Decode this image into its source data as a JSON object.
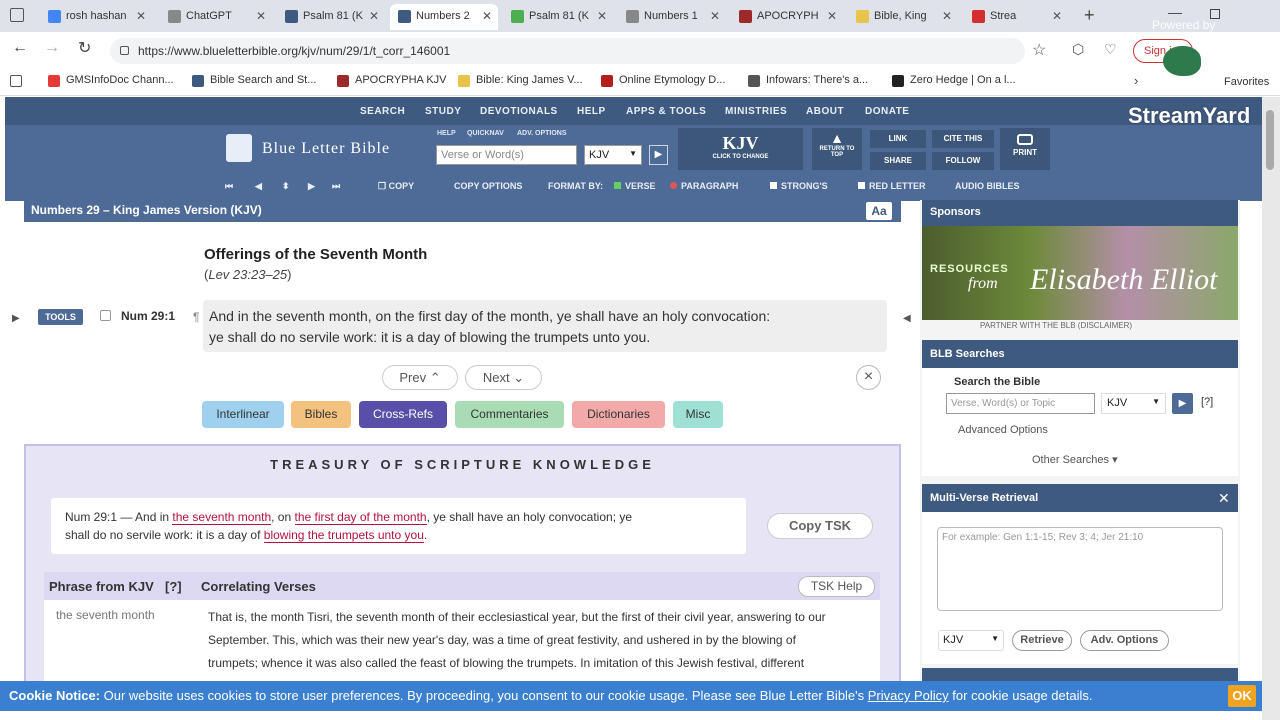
{
  "browser": {
    "tabs": [
      {
        "label": "rosh hashan",
        "color": "#4285f4"
      },
      {
        "label": "ChatGPT",
        "color": "#888888"
      },
      {
        "label": "Psalm 81 (K",
        "color": "#3f5a80"
      },
      {
        "label": "Numbers 2",
        "color": "#3f5a80",
        "active": true
      },
      {
        "label": "Psalm 81 (K",
        "color": "#4caf50"
      },
      {
        "label": "Numbers 1",
        "color": "#888888"
      },
      {
        "label": "APOCRYPH",
        "color": "#9c2a2a"
      },
      {
        "label": "Bible, King",
        "color": "#e8c44a"
      },
      {
        "label": "Strea",
        "color": "#d32f2f"
      }
    ],
    "url": "https://www.blueletterbible.org/kjv/num/29/1/t_corr_146001",
    "sign_in": "Sign in",
    "bookmarks": [
      {
        "label": "GMSInfoDoc Chann...",
        "color": "#e53935"
      },
      {
        "label": "Bible Search and St...",
        "color": "#3f5a80"
      },
      {
        "label": "APOCRYPHA KJV",
        "color": "#9c2a2a"
      },
      {
        "label": "Bible: King James V...",
        "color": "#e8c44a"
      },
      {
        "label": "Online Etymology D...",
        "color": "#b71c1c"
      },
      {
        "label": "Infowars: There's a...",
        "color": "#555555"
      },
      {
        "label": "Zero Hedge | On a l...",
        "color": "#222222"
      }
    ],
    "favorites": "Favorites"
  },
  "site": {
    "nav": [
      "SEARCH",
      "STUDY",
      "DEVOTIONALS",
      "HELP",
      "APPS & TOOLS",
      "MINISTRIES",
      "ABOUT",
      "DONATE"
    ],
    "logo": "Blue Letter Bible",
    "search_labels": [
      "HELP",
      "QUICKNAV",
      "ADV. OPTIONS"
    ],
    "search_placeholder": "Verse or Word(s)",
    "version": "KJV",
    "version_sub": "CLICK TO CHANGE",
    "return_top": "RETURN TO TOP",
    "link": "LINK",
    "share": "SHARE",
    "cite": "CITE THIS",
    "follow": "FOLLOW",
    "print": "PRINT",
    "toolbar": {
      "copy": "COPY",
      "copy_options": "COPY OPTIONS",
      "format_by": "FORMAT BY:",
      "verse": "VERSE",
      "paragraph": "PARAGRAPH",
      "strongs": "STRONG'S",
      "red_letter": "RED LETTER",
      "audio": "AUDIO BIBLES"
    }
  },
  "main": {
    "chapter_title": "Numbers 29 – King James Version (KJV)",
    "aa": "Aa",
    "heading": "Offerings of the Seventh Month",
    "heading_ref_prefix": "(",
    "heading_ref": "Lev 23:23–25",
    "heading_ref_suffix": ")",
    "tools": "TOOLS",
    "verse_ref": "Num 29:1",
    "verse_line1": "And in the seventh month, on the first day of the month, ye shall have an holy convocation:",
    "verse_line2": "ye shall do no servile work: it is a day of blowing the trumpets unto you.",
    "prev": "Prev",
    "next": "Next",
    "tabs": [
      {
        "label": "Interlinear",
        "color": "#9fd1ef"
      },
      {
        "label": "Bibles",
        "color": "#f3c27e"
      },
      {
        "label": "Cross-Refs",
        "color": "#5a4fa8"
      },
      {
        "label": "Commentaries",
        "color": "#a9dcb5"
      },
      {
        "label": "Dictionaries",
        "color": "#f2a9a9"
      },
      {
        "label": "Misc",
        "color": "#9fe0d4"
      }
    ],
    "tsk": {
      "title": "TREASURY OF SCRIPTURE KNOWLEDGE",
      "verse_ref": "Num 29:1 — And in",
      "hl1": "the seventh month",
      "t1": ", on",
      "hl2": "the first day of the month",
      "t2": ", ye shall have an holy convocation; ye",
      "t3": "shall do no servile work: it is a day of",
      "hl3": "blowing the trumpets unto you",
      "t4": ".",
      "copy_tsk": "Copy TSK",
      "col_phrase": "Phrase from KJV",
      "col_q": "[?]",
      "col_corr": "Correlating Verses",
      "help": "TSK Help",
      "row_phrase": "the seventh month",
      "row_comment_1": "That is, the month Tisri, the seventh month of their ecclesiastical year, but the first of their civil year, answering to our",
      "row_comment_2": "September. This, which was their new year's day, was a time of great festivity, and ushered in by the blowing of",
      "row_comment_3": "trumpets; whence it was also called the feast of blowing the trumpets. In imitation of this Jewish festival, different"
    }
  },
  "sidebar": {
    "sponsors": "Sponsors",
    "ad_resources": "RESOURCES",
    "ad_from": "from",
    "ad_name": "Elisabeth Elliot",
    "partner": "PARTNER WITH THE BLB    (DISCLAIMER)",
    "blb_searches": "BLB Searches",
    "search_the_bible": "Search the Bible",
    "search_placeholder": "Verse, Word(s) or Topic",
    "version": "KJV",
    "q": "[?]",
    "advanced_options": "Advanced Options",
    "other_searches": "Other Searches ▾",
    "multi_verse": "Multi-Verse Retrieval",
    "mv_placeholder": "For example: Gen 1:1-15; Rev 3; 4; Jer 21:10",
    "mv_version": "KJV",
    "retrieve": "Retrieve",
    "adv_options": "Adv. Options"
  },
  "cookie": {
    "label": "Cookie Notice:",
    "text": " Our website uses cookies to store user preferences. By proceeding, you consent to our cookie usage. Please see Blue Letter Bible's ",
    "link": "Privacy Policy",
    "text2": " for cookie usage details.",
    "ok": "OK"
  },
  "overlay": {
    "streamyard": "StreamYard",
    "powered_by": "Powered by"
  }
}
